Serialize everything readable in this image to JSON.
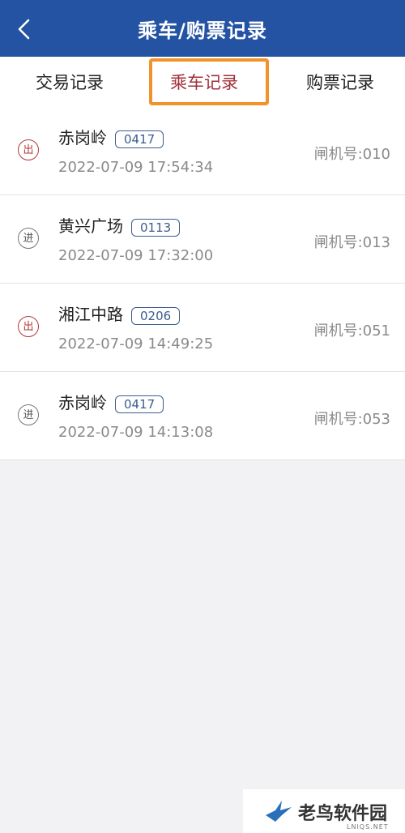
{
  "header": {
    "title": "乘车/购票记录",
    "back_icon": "chevron-left-icon"
  },
  "tabs": [
    {
      "label": "交易记录",
      "active": false
    },
    {
      "label": "乘车记录",
      "active": true
    },
    {
      "label": "购票记录",
      "active": false
    }
  ],
  "records": [
    {
      "direction": "出",
      "type": "exit",
      "station": "赤岗岭",
      "code": "0417",
      "time": "2022-07-09 17:54:34",
      "gate": "闸机号:010"
    },
    {
      "direction": "进",
      "type": "entry",
      "station": "黄兴广场",
      "code": "0113",
      "time": "2022-07-09 17:32:00",
      "gate": "闸机号:013"
    },
    {
      "direction": "出",
      "type": "exit",
      "station": "湘江中路",
      "code": "0206",
      "time": "2022-07-09 14:49:25",
      "gate": "闸机号:051"
    },
    {
      "direction": "进",
      "type": "entry",
      "station": "赤岗岭",
      "code": "0417",
      "time": "2022-07-09 14:13:08",
      "gate": "闸机号:053"
    }
  ],
  "watermark": {
    "text": "老鸟软件园",
    "sub": "LNIQS.NET"
  },
  "colors": {
    "header_bg": "#2453a3",
    "active_tab": "#a0303c",
    "highlight_border": "#f2922a",
    "exit_badge": "#b23a3a"
  }
}
